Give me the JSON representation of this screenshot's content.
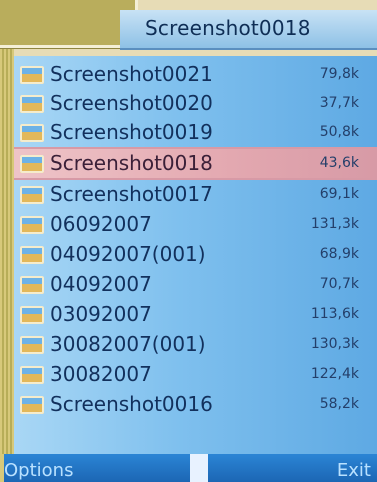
{
  "header": {
    "title": "Screenshot0018"
  },
  "files": [
    {
      "name": "Screenshot0021",
      "size": "79,8k"
    },
    {
      "name": "Screenshot0020",
      "size": "37,7k"
    },
    {
      "name": "Screenshot0019",
      "size": "50,8k"
    },
    {
      "name": "Screenshot0018",
      "size": "43,6k",
      "selected": true
    },
    {
      "name": "Screenshot0017",
      "size": "69,1k"
    },
    {
      "name": "06092007",
      "size": "131,3k"
    },
    {
      "name": "04092007(001)",
      "size": "68,9k"
    },
    {
      "name": "04092007",
      "size": "70,7k"
    },
    {
      "name": "03092007",
      "size": "113,6k"
    },
    {
      "name": "30082007(001)",
      "size": "130,3k"
    },
    {
      "name": "30082007",
      "size": "122,4k"
    },
    {
      "name": "Screenshot0016",
      "size": "58,2k"
    }
  ],
  "softkeys": {
    "left": "Options",
    "right": "Exit"
  },
  "icons": {
    "file": "image-file-icon"
  },
  "colors": {
    "selected_row": "#e3a8b0",
    "list_bg": "#7fc0ee",
    "softkey_bg": "#1c66b4"
  }
}
